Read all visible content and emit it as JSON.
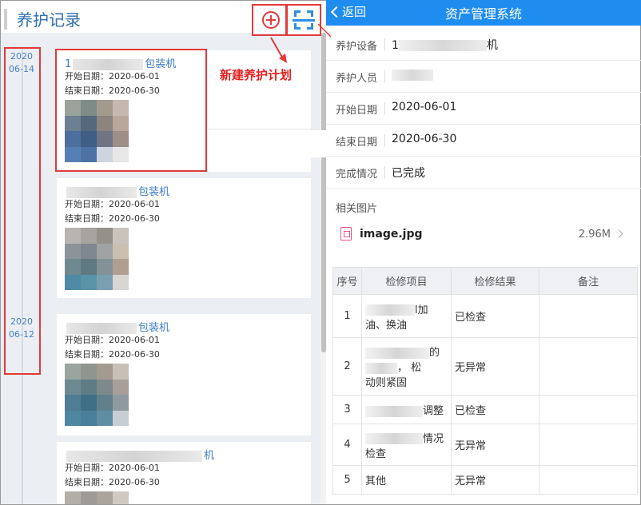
{
  "left": {
    "title": "养护记录",
    "annotation": "新建养护计划",
    "dates": [
      {
        "year": "2020",
        "day": "06-14"
      },
      {
        "year": "2020",
        "day": "06-12"
      }
    ],
    "cards": [
      {
        "prefix": "1",
        "suffix": "包装机",
        "start": "开始日期：2020-06-01",
        "end": "结束日期：2020-06-30"
      },
      {
        "prefix": "",
        "suffix": "包装机",
        "start": "开始日期：2020-06-01",
        "end": "结束日期：2020-06-30"
      },
      {
        "prefix": "",
        "suffix": "包装机",
        "start": "开始日期：2020-06-01",
        "end": "结束日期：2020-06-30"
      },
      {
        "prefix": "",
        "suffix": "机",
        "start": "开始日期：2020-06-01",
        "end": "结束日期：2020-06-30"
      }
    ]
  },
  "right": {
    "back_label": "返回",
    "title": "资产管理系统",
    "fields": [
      {
        "label": "养护设备",
        "value_prefix": "1",
        "value_suffix": "机"
      },
      {
        "label": "养护人员",
        "value": ""
      },
      {
        "label": "开始日期",
        "value": "2020-06-01"
      },
      {
        "label": "结束日期",
        "value": "2020-06-30"
      },
      {
        "label": "完成情况",
        "value": "已完成"
      }
    ],
    "images_label": "相关图片",
    "file": {
      "name": "image.jpg",
      "size": "2.96M"
    },
    "table": {
      "headers": [
        "序号",
        "检修项目",
        "检修结果",
        "备注"
      ],
      "rows": [
        {
          "no": "1",
          "item_a": "l加",
          "item_b": "油、换油",
          "result": "已检查",
          "note": ""
        },
        {
          "no": "2",
          "item_a": "的",
          "item_b": "，  松",
          "item_c": "动则紧固",
          "result": "无异常",
          "note": ""
        },
        {
          "no": "3",
          "item_a": "调整",
          "result": "已检查",
          "note": ""
        },
        {
          "no": "4",
          "item_a": "情况",
          "item_b": "检查",
          "result": "无异常",
          "note": ""
        },
        {
          "no": "5",
          "item_a": "其他",
          "result": "无异常",
          "note": ""
        }
      ]
    }
  }
}
